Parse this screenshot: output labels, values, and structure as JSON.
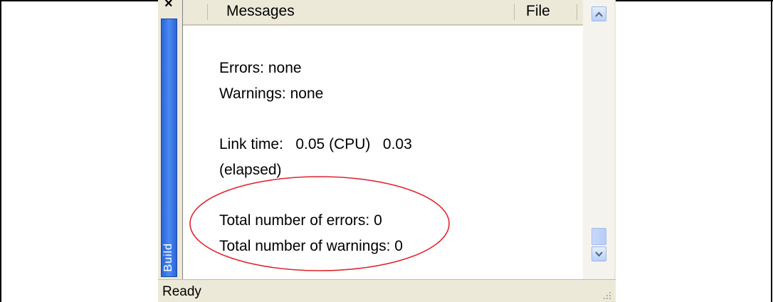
{
  "build_tab": {
    "label": "Build",
    "close_glyph": "×"
  },
  "header": {
    "messages_label": "Messages",
    "file_label": "File"
  },
  "messages": [
    "Errors: none",
    "Warnings: none",
    "",
    "Link time:   0.05 (CPU)   0.03",
    "(elapsed)",
    "",
    "Total number of errors: 0",
    "Total number of warnings: 0"
  ],
  "highlight": {
    "shape": "ellipse",
    "color": "#e0242b"
  },
  "scrollbar": {
    "up_icon": "chevron-up-icon",
    "down_icon": "chevron-down-icon"
  },
  "status": {
    "text": "Ready"
  }
}
